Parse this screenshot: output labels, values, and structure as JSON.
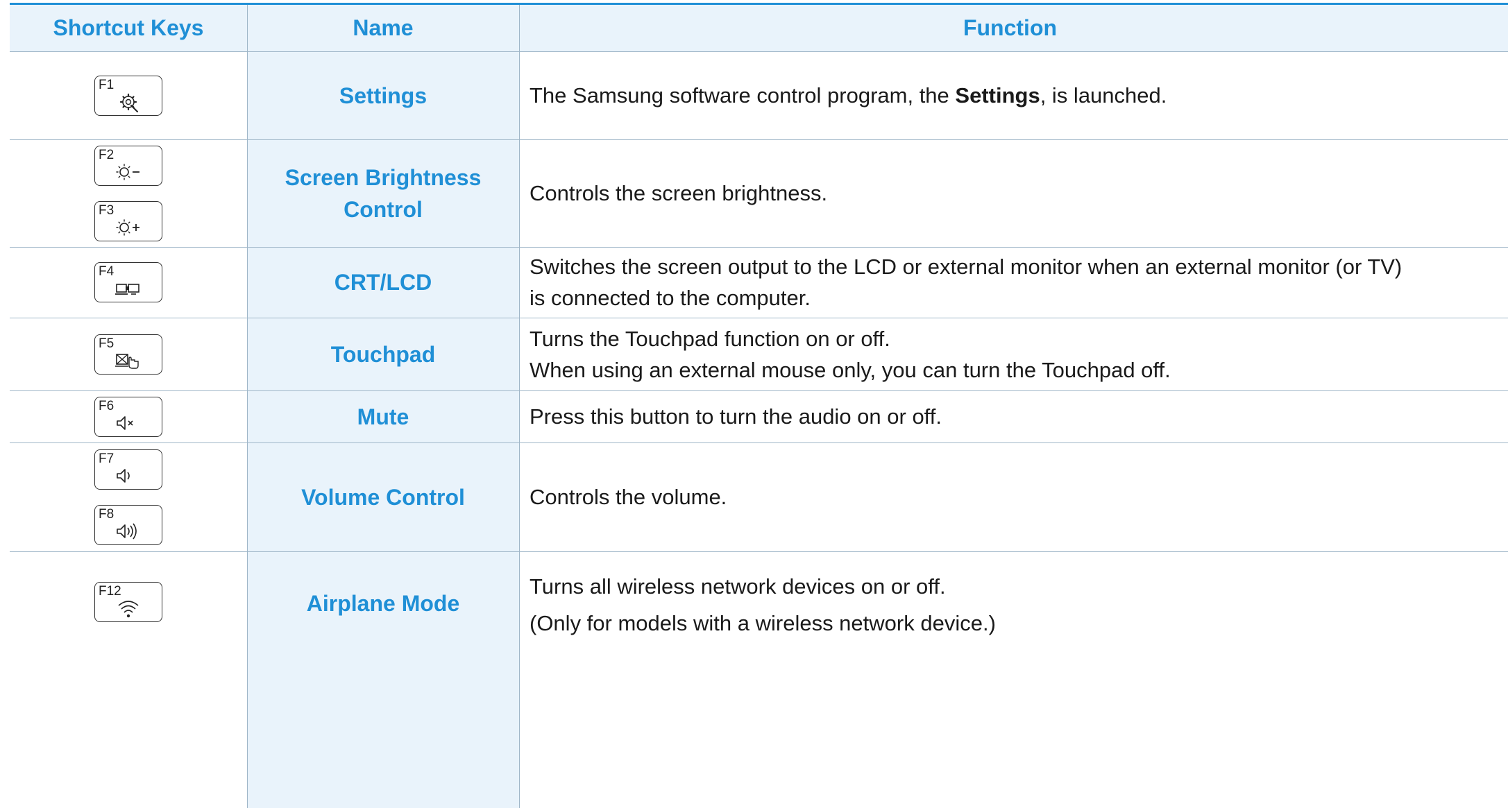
{
  "header": {
    "col_keys": "Shortcut Keys",
    "col_name": "Name",
    "col_function": "Function"
  },
  "rows": [
    {
      "keys": [
        {
          "label": "F1",
          "icon": "settings-gear-icon"
        }
      ],
      "name": "Settings",
      "function": {
        "pre": "The Samsung software control program, the ",
        "bold": "Settings",
        "post": ", is launched."
      }
    },
    {
      "keys": [
        {
          "label": "F2",
          "icon": "brightness-down-icon"
        },
        {
          "label": "F3",
          "icon": "brightness-up-icon"
        }
      ],
      "name": "Screen Brightness Control",
      "function": {
        "lines": [
          "Controls the screen brightness."
        ]
      }
    },
    {
      "keys": [
        {
          "label": "F4",
          "icon": "display-switch-icon"
        }
      ],
      "name": "CRT/LCD",
      "function": {
        "lines": [
          "Switches the screen output to the LCD or external monitor when an external monitor (or TV)",
          "is connected to the computer."
        ]
      }
    },
    {
      "keys": [
        {
          "label": "F5",
          "icon": "touchpad-icon"
        }
      ],
      "name": "Touchpad",
      "function": {
        "lines": [
          "Turns the Touchpad function on or off.",
          "When using an external mouse only, you can turn the Touchpad off."
        ]
      }
    },
    {
      "keys": [
        {
          "label": "F6",
          "icon": "mute-icon"
        }
      ],
      "name": "Mute",
      "function": {
        "lines": [
          "Press this button to turn the audio on or off."
        ]
      }
    },
    {
      "keys": [
        {
          "label": "F7",
          "icon": "volume-down-icon"
        },
        {
          "label": "F8",
          "icon": "volume-up-icon"
        }
      ],
      "name": "Volume Control",
      "function": {
        "lines": [
          "Controls the volume."
        ]
      }
    },
    {
      "keys": [
        {
          "label": "F12",
          "icon": "wireless-icon"
        }
      ],
      "name": "Airplane Mode",
      "function": {
        "lines": [
          "Turns all wireless network devices on or off.",
          "(Only for models with a wireless network device.)"
        ]
      }
    }
  ],
  "colors": {
    "accent": "#1f8fd6",
    "name_column_bg": "#e9f3fb",
    "grid_line": "#9fb6c8",
    "body_text": "#1a1a1a"
  }
}
